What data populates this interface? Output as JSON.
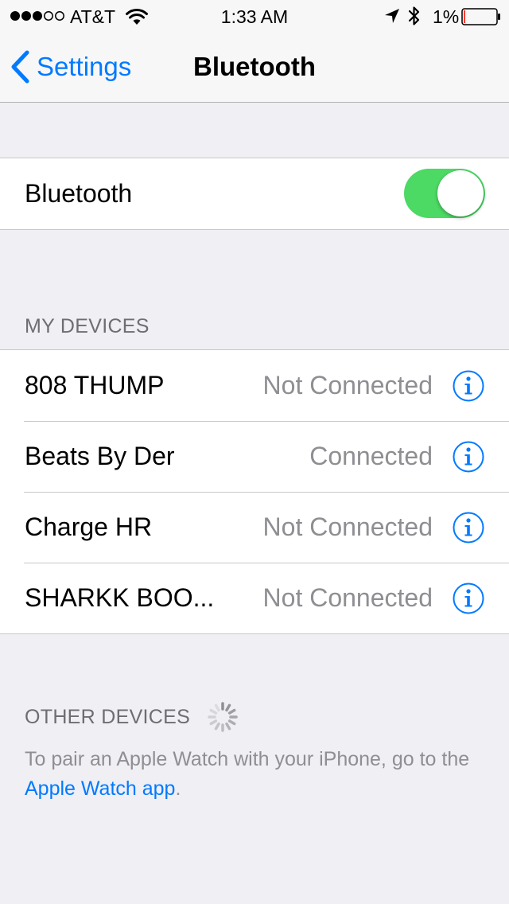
{
  "status_bar": {
    "carrier": "AT&T",
    "time": "1:33 AM",
    "battery": "1%",
    "signal_dots_filled": 3,
    "signal_dots_total": 5
  },
  "nav": {
    "back_label": "Settings",
    "title": "Bluetooth"
  },
  "bluetooth_toggle": {
    "label": "Bluetooth",
    "on": true
  },
  "my_devices": {
    "header": "MY DEVICES",
    "devices": [
      {
        "name": "808 THUMP",
        "status": "Not Connected"
      },
      {
        "name": "Beats By Der",
        "status": "Connected"
      },
      {
        "name": "Charge HR",
        "status": "Not Connected"
      },
      {
        "name": "SHARKK  BOO...",
        "status": "Not Connected"
      }
    ]
  },
  "other_devices": {
    "header": "OTHER DEVICES",
    "footer_prefix": "To pair an Apple Watch with your iPhone, go to the ",
    "footer_link": "Apple Watch app",
    "footer_suffix": "."
  },
  "colors": {
    "accent": "#007aff",
    "toggle_on": "#4cd964",
    "secondary_text": "#8e8e93",
    "battery_low": "#ff3b30"
  }
}
